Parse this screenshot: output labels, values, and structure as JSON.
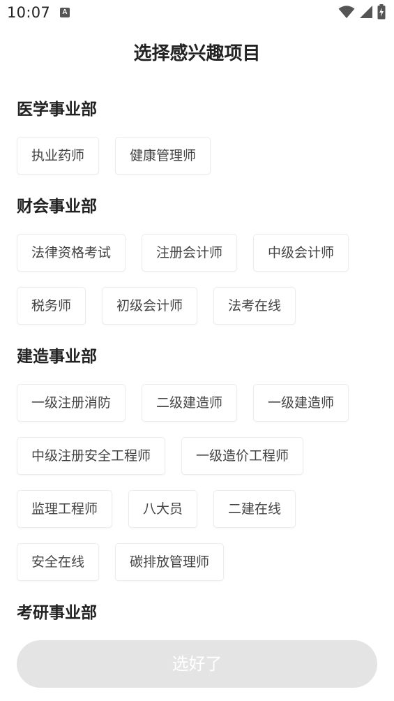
{
  "status_bar": {
    "time": "10:07",
    "app_icon_letter": "A",
    "icons": [
      "wifi-icon",
      "signal-icon",
      "battery-charging-icon"
    ]
  },
  "title": "选择感兴趣项目",
  "sections": [
    {
      "title": "医学事业部",
      "tags": [
        "执业药师",
        "健康管理师"
      ]
    },
    {
      "title": "财会事业部",
      "tags": [
        "法律资格考试",
        "注册会计师",
        "中级会计师",
        "税务师",
        "初级会计师",
        "法考在线"
      ]
    },
    {
      "title": "建造事业部",
      "tags": [
        "一级注册消防",
        "二级建造师",
        "一级建造师",
        "中级注册安全工程师",
        "一级造价工程师",
        "监理工程师",
        "八大员",
        "二建在线",
        "安全在线",
        "碳排放管理师"
      ]
    },
    {
      "title": "考研事业部",
      "tags": []
    }
  ],
  "confirm_button": "选好了",
  "colors": {
    "button_bg": "#e4e4e4",
    "tag_border": "#ececec",
    "text": "#222222"
  }
}
